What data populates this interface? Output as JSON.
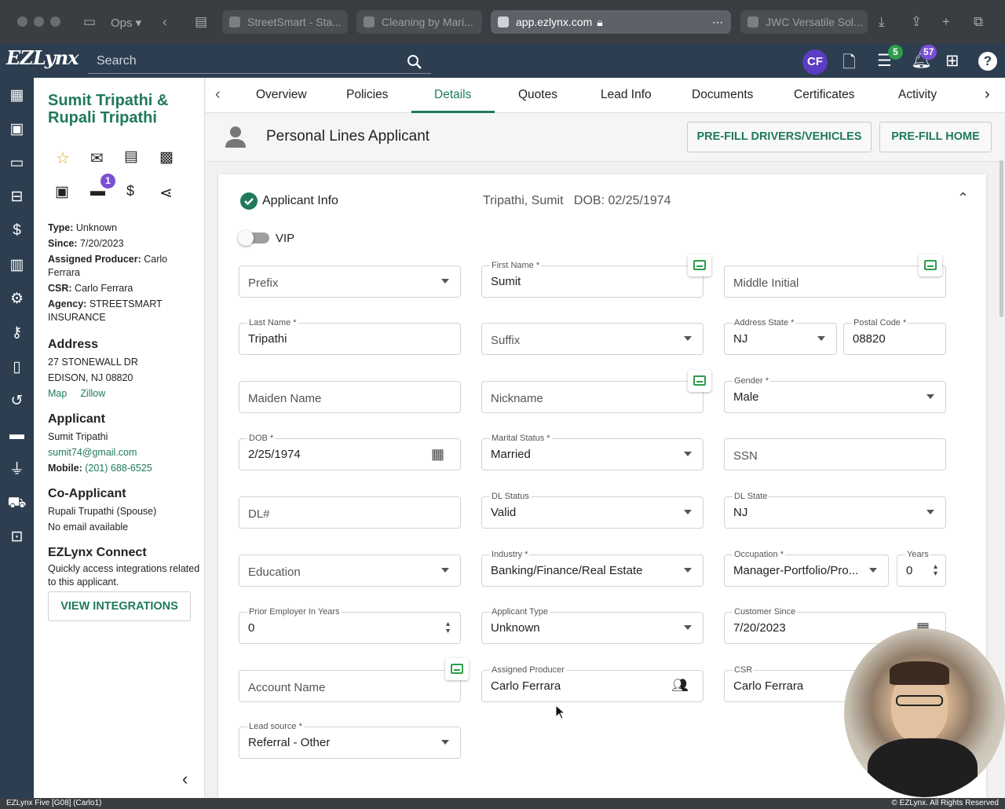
{
  "browser": {
    "profile": "Ops",
    "tabs": [
      {
        "label": "StreetSmart - Sta..."
      },
      {
        "label": "Cleaning by Mari..."
      },
      {
        "label": "app.ezlynx.com"
      },
      {
        "label": "JWC Versatile Sol..."
      }
    ]
  },
  "app": {
    "logo": "EZLynx",
    "search_placeholder": "Search",
    "user_initials": "CF",
    "tasks_badge": "5",
    "notifications_badge": "57"
  },
  "client": {
    "name": "Sumit Tripathi & Rupali Tripathi",
    "action_badge": "1",
    "type_label": "Type:",
    "type": "Unknown",
    "since_label": "Since:",
    "since": "7/20/2023",
    "producer_label": "Assigned Producer:",
    "producer": "Carlo Ferrara",
    "csr_label": "CSR:",
    "csr": "Carlo Ferrara",
    "agency_label": "Agency:",
    "agency": "STREETSMART INSURANCE",
    "address_title": "Address",
    "address_line1": "27 STONEWALL DR",
    "address_line2": "EDISON, NJ 08820",
    "map_link": "Map",
    "zillow_link": "Zillow",
    "applicant_title": "Applicant",
    "applicant_name": "Sumit Tripathi",
    "applicant_email": "sumit74@gmail.com",
    "mobile_label": "Mobile:",
    "mobile": "(201) 688-6525",
    "coapplicant_title": "Co-Applicant",
    "coapplicant_name": "Rupali Trupathi (Spouse)",
    "coapplicant_email": "No email available",
    "connect_title": "EZLynx Connect",
    "connect_desc": "Quickly access integrations related to this applicant.",
    "view_integrations": "VIEW INTEGRATIONS"
  },
  "tabs": [
    "Overview",
    "Policies",
    "Details",
    "Quotes",
    "Lead Info",
    "Documents",
    "Certificates",
    "Activity"
  ],
  "header": {
    "title": "Personal Lines Applicant",
    "prefill_drivers": "PRE-FILL DRIVERS/VEHICLES",
    "prefill_home": "PRE-FILL HOME"
  },
  "section": {
    "title": "Applicant Info",
    "summary": "Tripathi, Sumit   DOB: 02/25/1974",
    "vip_label": "VIP"
  },
  "form": {
    "prefix": {
      "placeholder": "Prefix"
    },
    "first_name": {
      "label": "First Name *",
      "value": "Sumit"
    },
    "middle_initial": {
      "placeholder": "Middle Initial"
    },
    "last_name": {
      "label": "Last Name *",
      "value": "Tripathi"
    },
    "suffix": {
      "placeholder": "Suffix"
    },
    "address_state": {
      "label": "Address State *",
      "value": "NJ"
    },
    "postal_code": {
      "label": "Postal Code *",
      "value": "08820"
    },
    "maiden_name": {
      "placeholder": "Maiden Name"
    },
    "nickname": {
      "placeholder": "Nickname"
    },
    "gender": {
      "label": "Gender *",
      "value": "Male"
    },
    "dob": {
      "label": "DOB *",
      "value": "2/25/1974"
    },
    "marital_status": {
      "label": "Marital Status *",
      "value": "Married"
    },
    "ssn": {
      "placeholder": "SSN"
    },
    "dl_number": {
      "placeholder": "DL#"
    },
    "dl_status": {
      "label": "DL Status",
      "value": "Valid"
    },
    "dl_state": {
      "label": "DL State",
      "value": "NJ"
    },
    "education": {
      "placeholder": "Education"
    },
    "industry": {
      "label": "Industry *",
      "value": "Banking/Finance/Real Estate"
    },
    "occupation": {
      "label": "Occupation *",
      "value": "Manager-Portfolio/Pro..."
    },
    "years": {
      "label": "Years",
      "value": "0"
    },
    "prior_employer": {
      "label": "Prior Employer In Years",
      "value": "0"
    },
    "applicant_type": {
      "label": "Applicant Type",
      "value": "Unknown"
    },
    "customer_since": {
      "label": "Customer Since",
      "value": "7/20/2023"
    },
    "account_name": {
      "placeholder": "Account Name"
    },
    "assigned_producer": {
      "label": "Assigned Producer",
      "value": "Carlo Ferrara"
    },
    "csr": {
      "label": "CSR",
      "value": "Carlo Ferrara"
    },
    "lead_source": {
      "label": "Lead source *",
      "value": "Referral - Other"
    }
  },
  "statusbar": {
    "left": "EZLynx Five [G08] (Carlo1)",
    "right": "© EZLynx. All Rights Reserved"
  },
  "colors": {
    "nav": "#2c3e50",
    "accent": "#1f7a5a",
    "badge_green": "#2e9c4c",
    "badge_purple": "#7b4fd6"
  }
}
